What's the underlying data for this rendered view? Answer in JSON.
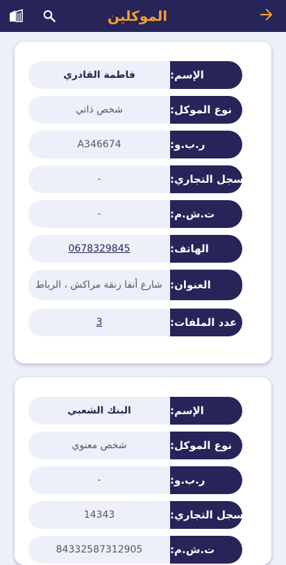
{
  "header": {
    "title": "الموكلين"
  },
  "clients": [
    {
      "fields": [
        {
          "label": "الإسم:",
          "value": "فاطمة القادري"
        },
        {
          "label": "نوع الموكل:",
          "value": "شخص ذاتي"
        },
        {
          "label": "ر.ب.و:",
          "value": "A346674"
        },
        {
          "label": "السجل التجاري:",
          "value": "-"
        },
        {
          "label": "ت.ش.م:",
          "value": "-"
        },
        {
          "label": "الهاتف:",
          "value": "0678329845"
        },
        {
          "label": "العنوان:",
          "value": "شارع أنفا زنقة مراكش ، الرباط"
        },
        {
          "label": "عدد الملفات:",
          "value": "3"
        }
      ]
    },
    {
      "fields": [
        {
          "label": "الإسم:",
          "value": "البنك الشعبي"
        },
        {
          "label": "نوع الموكل:",
          "value": "شخص معنوي"
        },
        {
          "label": "ر.ب.و:",
          "value": "-"
        },
        {
          "label": "السجل التجاري:",
          "value": "14343"
        },
        {
          "label": "ت.ش.م:",
          "value": "84332587312905"
        }
      ]
    }
  ],
  "icons": {
    "back": "arrow-right-icon",
    "search": "search-icon",
    "logo": "building-icon"
  },
  "colors": {
    "primary": "#262459",
    "accent": "#f2a02f",
    "background": "#eef0f9"
  }
}
